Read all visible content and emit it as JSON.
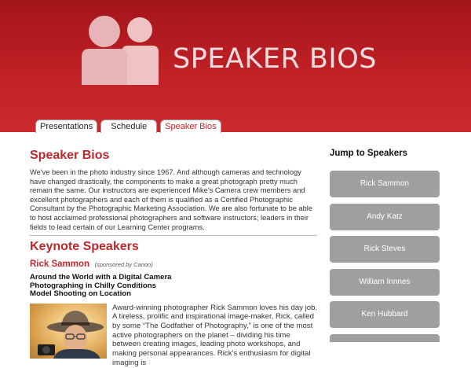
{
  "header": {
    "title": "SPEAKER BIOS"
  },
  "tabs": [
    {
      "label": "Presentations",
      "active": false
    },
    {
      "label": "Schedule",
      "active": false
    },
    {
      "label": "Speaker Bios",
      "active": true
    }
  ],
  "main": {
    "title": "Speaker Bios",
    "intro": "We've been in the photo industry since 1967. And although cameras and technology have changed drastically, the components to make a great photograph pretty much remain the same. Our instructors are experienced Mike's Camera crew members and excellent photographers and each of them is qualified as a Certified Photographic Consultant by the Photographic Marketing Association. We are also fortunate to be able to host acclaimed professional photographers and software instructors; leaders in their fields to lead certain of our Learning Center programs.",
    "keynote_title": "Keynote Speakers",
    "speaker": {
      "name": "Rick Sammon",
      "sponsor": "(sponsored by Canon)",
      "talks": [
        "Around the World with a Digital Camera",
        "Photographing in Chilly Conditions",
        "Model Shooting on Location"
      ],
      "bio": "Award-winning photographer Rick Sammon loves his day job. A tireless, prolific and inspirational image-maker, Rick, called by some “The Godfather of Photography,” is one of the most active photographers on the planet – dividing his time between creating images, leading photo workshops, and making personal appearances. Rick's enthusiasm for digital imaging is"
    }
  },
  "sidebar": {
    "title": "Jump to Speakers",
    "speakers": [
      "Rick Sammon",
      "Andy Katz",
      "Rick Steves",
      "William Innnes",
      "Ken Hubbard"
    ]
  },
  "colors": {
    "accent": "#c0272d",
    "header": "#bf2127",
    "button": "#9f9f9f"
  }
}
